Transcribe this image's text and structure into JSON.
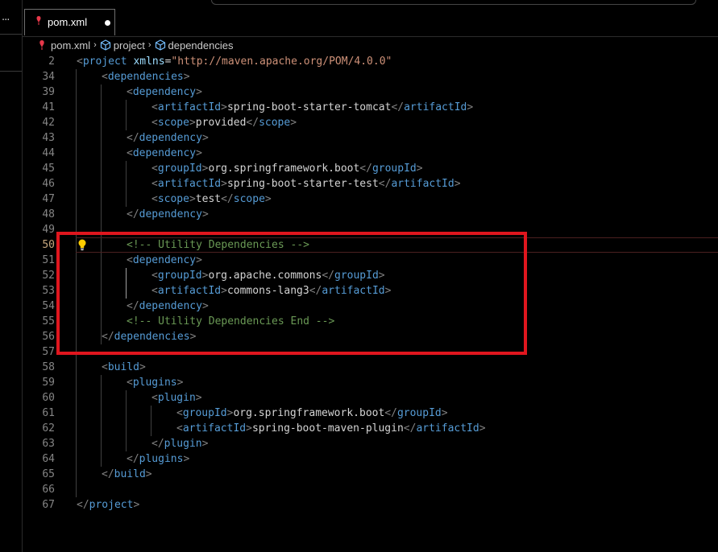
{
  "window": {
    "more_actions_icon": "ellipsis-icon"
  },
  "tab": {
    "label": "pom.xml",
    "icon": "xml-file-icon",
    "unsaved": true
  },
  "breadcrumb": {
    "file": "pom.xml",
    "items": [
      "project",
      "dependencies"
    ],
    "icon": "symbol-tag-icon"
  },
  "editor": {
    "active_line": "50",
    "lightbulb_icon": "lightbulb-icon",
    "lines": [
      {
        "n": "2",
        "indent": 0,
        "tokens": [
          [
            "b",
            "<"
          ],
          [
            "t",
            "project"
          ],
          [
            "x",
            " "
          ],
          [
            "a",
            "xmlns"
          ],
          [
            "x",
            "="
          ],
          [
            "s",
            "\"http://maven.apache.org/POM/4.0.0\""
          ]
        ]
      },
      {
        "n": "34",
        "indent": 1,
        "tokens": [
          [
            "b",
            "<"
          ],
          [
            "t",
            "dependencies"
          ],
          [
            "b",
            ">"
          ]
        ]
      },
      {
        "n": "39",
        "indent": 2,
        "tokens": [
          [
            "b",
            "<"
          ],
          [
            "t",
            "dependency"
          ],
          [
            "b",
            ">"
          ]
        ]
      },
      {
        "n": "41",
        "indent": 3,
        "tokens": [
          [
            "b",
            "<"
          ],
          [
            "t",
            "artifactId"
          ],
          [
            "b",
            ">"
          ],
          [
            "x",
            "spring-boot-starter-tomcat"
          ],
          [
            "b",
            "</"
          ],
          [
            "t",
            "artifactId"
          ],
          [
            "b",
            ">"
          ]
        ]
      },
      {
        "n": "42",
        "indent": 3,
        "tokens": [
          [
            "b",
            "<"
          ],
          [
            "t",
            "scope"
          ],
          [
            "b",
            ">"
          ],
          [
            "x",
            "provided"
          ],
          [
            "b",
            "</"
          ],
          [
            "t",
            "scope"
          ],
          [
            "b",
            ">"
          ]
        ]
      },
      {
        "n": "43",
        "indent": 2,
        "tokens": [
          [
            "b",
            "</"
          ],
          [
            "t",
            "dependency"
          ],
          [
            "b",
            ">"
          ]
        ]
      },
      {
        "n": "44",
        "indent": 2,
        "tokens": [
          [
            "b",
            "<"
          ],
          [
            "t",
            "dependency"
          ],
          [
            "b",
            ">"
          ]
        ]
      },
      {
        "n": "45",
        "indent": 3,
        "tokens": [
          [
            "b",
            "<"
          ],
          [
            "t",
            "groupId"
          ],
          [
            "b",
            ">"
          ],
          [
            "x",
            "org.springframework.boot"
          ],
          [
            "b",
            "</"
          ],
          [
            "t",
            "groupId"
          ],
          [
            "b",
            ">"
          ]
        ]
      },
      {
        "n": "46",
        "indent": 3,
        "tokens": [
          [
            "b",
            "<"
          ],
          [
            "t",
            "artifactId"
          ],
          [
            "b",
            ">"
          ],
          [
            "x",
            "spring-boot-starter-test"
          ],
          [
            "b",
            "</"
          ],
          [
            "t",
            "artifactId"
          ],
          [
            "b",
            ">"
          ]
        ]
      },
      {
        "n": "47",
        "indent": 3,
        "tokens": [
          [
            "b",
            "<"
          ],
          [
            "t",
            "scope"
          ],
          [
            "b",
            ">"
          ],
          [
            "x",
            "test"
          ],
          [
            "b",
            "</"
          ],
          [
            "t",
            "scope"
          ],
          [
            "b",
            ">"
          ]
        ]
      },
      {
        "n": "48",
        "indent": 2,
        "tokens": [
          [
            "b",
            "</"
          ],
          [
            "t",
            "dependency"
          ],
          [
            "b",
            ">"
          ]
        ]
      },
      {
        "n": "49",
        "indent": 0,
        "tokens": []
      },
      {
        "n": "50",
        "indent": 2,
        "tokens": [
          [
            "c",
            "<!-- Utility Dependencies -->"
          ]
        ]
      },
      {
        "n": "51",
        "indent": 2,
        "tokens": [
          [
            "b",
            "<"
          ],
          [
            "t",
            "dependency"
          ],
          [
            "b",
            ">"
          ]
        ]
      },
      {
        "n": "52",
        "indent": 3,
        "tokens": [
          [
            "b",
            "<"
          ],
          [
            "t",
            "groupId"
          ],
          [
            "b",
            ">"
          ],
          [
            "x",
            "org.apache.commons"
          ],
          [
            "b",
            "</"
          ],
          [
            "t",
            "groupId"
          ],
          [
            "b",
            ">"
          ]
        ]
      },
      {
        "n": "53",
        "indent": 3,
        "tokens": [
          [
            "b",
            "<"
          ],
          [
            "t",
            "artifactId"
          ],
          [
            "b",
            ">"
          ],
          [
            "x",
            "commons-lang3"
          ],
          [
            "b",
            "</"
          ],
          [
            "t",
            "artifactId"
          ],
          [
            "b",
            ">"
          ]
        ]
      },
      {
        "n": "54",
        "indent": 2,
        "tokens": [
          [
            "b",
            "</"
          ],
          [
            "t",
            "dependency"
          ],
          [
            "b",
            ">"
          ]
        ]
      },
      {
        "n": "55",
        "indent": 2,
        "tokens": [
          [
            "c",
            "<!-- Utility Dependencies End -->"
          ]
        ]
      },
      {
        "n": "56",
        "indent": 1,
        "tokens": [
          [
            "b",
            "</"
          ],
          [
            "t",
            "dependencies"
          ],
          [
            "b",
            ">"
          ]
        ]
      },
      {
        "n": "57",
        "indent": 0,
        "tokens": []
      },
      {
        "n": "58",
        "indent": 1,
        "tokens": [
          [
            "b",
            "<"
          ],
          [
            "t",
            "build"
          ],
          [
            "b",
            ">"
          ]
        ]
      },
      {
        "n": "59",
        "indent": 2,
        "tokens": [
          [
            "b",
            "<"
          ],
          [
            "t",
            "plugins"
          ],
          [
            "b",
            ">"
          ]
        ]
      },
      {
        "n": "60",
        "indent": 3,
        "tokens": [
          [
            "b",
            "<"
          ],
          [
            "t",
            "plugin"
          ],
          [
            "b",
            ">"
          ]
        ]
      },
      {
        "n": "61",
        "indent": 4,
        "tokens": [
          [
            "b",
            "<"
          ],
          [
            "t",
            "groupId"
          ],
          [
            "b",
            ">"
          ],
          [
            "x",
            "org.springframework.boot"
          ],
          [
            "b",
            "</"
          ],
          [
            "t",
            "groupId"
          ],
          [
            "b",
            ">"
          ]
        ]
      },
      {
        "n": "62",
        "indent": 4,
        "tokens": [
          [
            "b",
            "<"
          ],
          [
            "t",
            "artifactId"
          ],
          [
            "b",
            ">"
          ],
          [
            "x",
            "spring-boot-maven-plugin"
          ],
          [
            "b",
            "</"
          ],
          [
            "t",
            "artifactId"
          ],
          [
            "b",
            ">"
          ]
        ]
      },
      {
        "n": "63",
        "indent": 3,
        "tokens": [
          [
            "b",
            "</"
          ],
          [
            "t",
            "plugin"
          ],
          [
            "b",
            ">"
          ]
        ]
      },
      {
        "n": "64",
        "indent": 2,
        "tokens": [
          [
            "b",
            "</"
          ],
          [
            "t",
            "plugins"
          ],
          [
            "b",
            ">"
          ]
        ]
      },
      {
        "n": "65",
        "indent": 1,
        "tokens": [
          [
            "b",
            "</"
          ],
          [
            "t",
            "build"
          ],
          [
            "b",
            ">"
          ]
        ]
      },
      {
        "n": "66",
        "indent": 0,
        "tokens": []
      },
      {
        "n": "67",
        "indent": 0,
        "tokens": [
          [
            "b",
            "</"
          ],
          [
            "t",
            "project"
          ],
          [
            "b",
            ">"
          ]
        ]
      }
    ]
  },
  "annotation": {
    "color": "#e0161e"
  },
  "colors": {
    "background": "#000000",
    "tag": "#569cd6",
    "attribute": "#9cdcfe",
    "string": "#ce9178",
    "comment": "#6a9955",
    "text": "#d4d4d4",
    "line_number": "#858585"
  }
}
